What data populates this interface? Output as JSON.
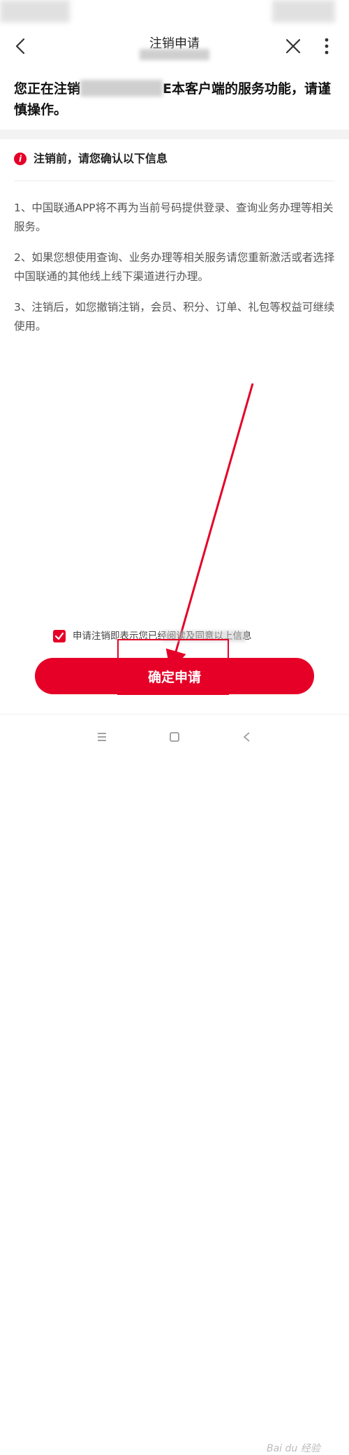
{
  "header": {
    "title": "注销申请",
    "back_icon": "chevron-left-icon",
    "close_icon": "close-icon",
    "more_icon": "more-vertical-icon"
  },
  "notice": {
    "prefix": "您正在注销",
    "suffix": "E本客户端的服务功能，请谨慎操作。"
  },
  "info": {
    "icon": "info-icon",
    "heading": "注销前，请您确认以下信息"
  },
  "items": [
    "1、中国联通APP将不再为当前号码提供登录、查询业务办理等相关服务。",
    "2、如果您想使用查询、业务办理等相关服务请您重新激活或者选择中国联通的其他线上线下渠道进行办理。",
    "3、注销后，如您撤销注销，会员、积分、订单、礼包等权益可继续使用。"
  ],
  "agreement": {
    "checked": true,
    "text": "申请注销即表示您已经阅读及同意以上信息"
  },
  "confirm_label": "确定申请",
  "navbar": {
    "menu_icon": "menu-icon",
    "home_icon": "home-square-icon",
    "back_icon": "back-triangle-icon",
    "watermark": "Bai du 经验"
  },
  "colors": {
    "accent": "#e60027",
    "band": "#f3f3f3"
  }
}
